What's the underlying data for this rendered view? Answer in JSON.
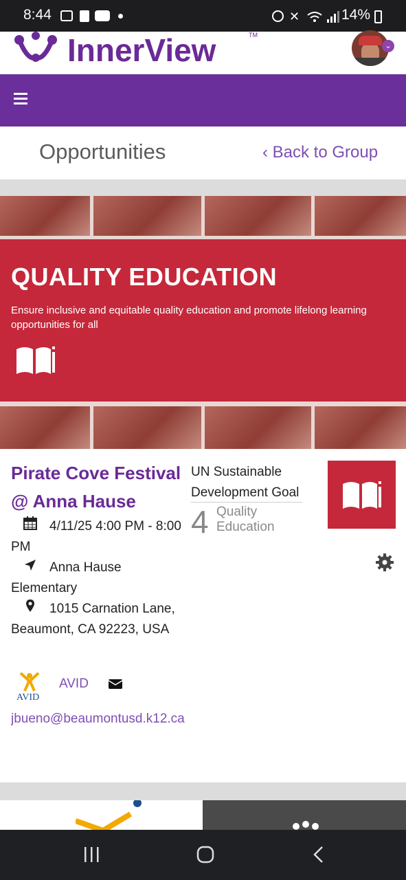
{
  "status_bar": {
    "time": "8:44",
    "battery": "14%"
  },
  "header": {
    "logo_text": "InnerView",
    "logo_tm": "TM"
  },
  "page": {
    "title": "Opportunities",
    "back_link": "‹ Back to Group"
  },
  "banner": {
    "title": "QUALITY EDUCATION",
    "subtitle": "Ensure inclusive and equitable quality education and promote lifelong learning opportunities for all"
  },
  "event": {
    "title": "Pirate Cove Festival @ Anna Hause",
    "datetime": "4/11/25 4:00 PM - 8:00 PM",
    "location_name": "Anna Hause Elementary",
    "address": "1015 Carnation Lane, Beaumont, CA 92223, USA",
    "organization": "AVID",
    "email": "jbueno@beaumontusd.k12.ca"
  },
  "sdg": {
    "label": "UN Sustainable Development Goal",
    "number": "4",
    "name": "Quality Education"
  },
  "colors": {
    "brand_purple": "#6a2f9a",
    "sdg_red": "#c5283a",
    "link_purple": "#7e4fb3"
  }
}
